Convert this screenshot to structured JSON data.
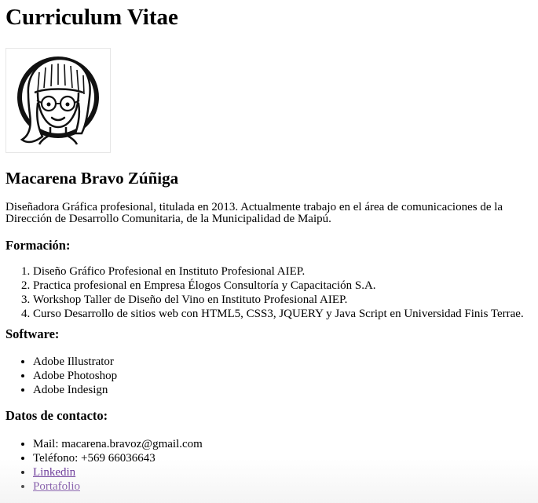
{
  "page": {
    "title": "Curriculum Vitae"
  },
  "profile": {
    "name": "Macarena Bravo Zúñiga",
    "bio": "Diseñadora Gráfica profesional, titulada en 2013. Actualmente trabajo en el área de comunicaciones de la Dirección de Desarrollo Comunitaria, de la Municipalidad de Maipú.",
    "avatar_icon": "illustrated-portrait"
  },
  "formacion": {
    "heading": "Formación:",
    "items": [
      "Diseño Gráfico Profesional en Instituto Profesional AIEP.",
      "Practica profesional en Empresa Élogos Consultoría y Capacitación S.A.",
      "Workshop Taller de Diseño del Vino en Instituto Profesional AIEP.",
      "Curso Desarrollo de sitios web con HTML5, CSS3, JQUERY y Java Script en Universidad Finis Terrae."
    ]
  },
  "software": {
    "heading": "Software:",
    "items": [
      "Adobe Illustrator",
      "Adobe Photoshop",
      "Adobe Indesign"
    ]
  },
  "contacto": {
    "heading": "Datos de contacto:",
    "mail": "Mail: macarena.bravoz@gmail.com",
    "telefono": "Teléfono: +569 66036643",
    "linkedin": "Linkedin",
    "portafolio": "Portafolio"
  },
  "colors": {
    "link": "#551a8b",
    "text": "#000000",
    "background": "#ffffff"
  }
}
